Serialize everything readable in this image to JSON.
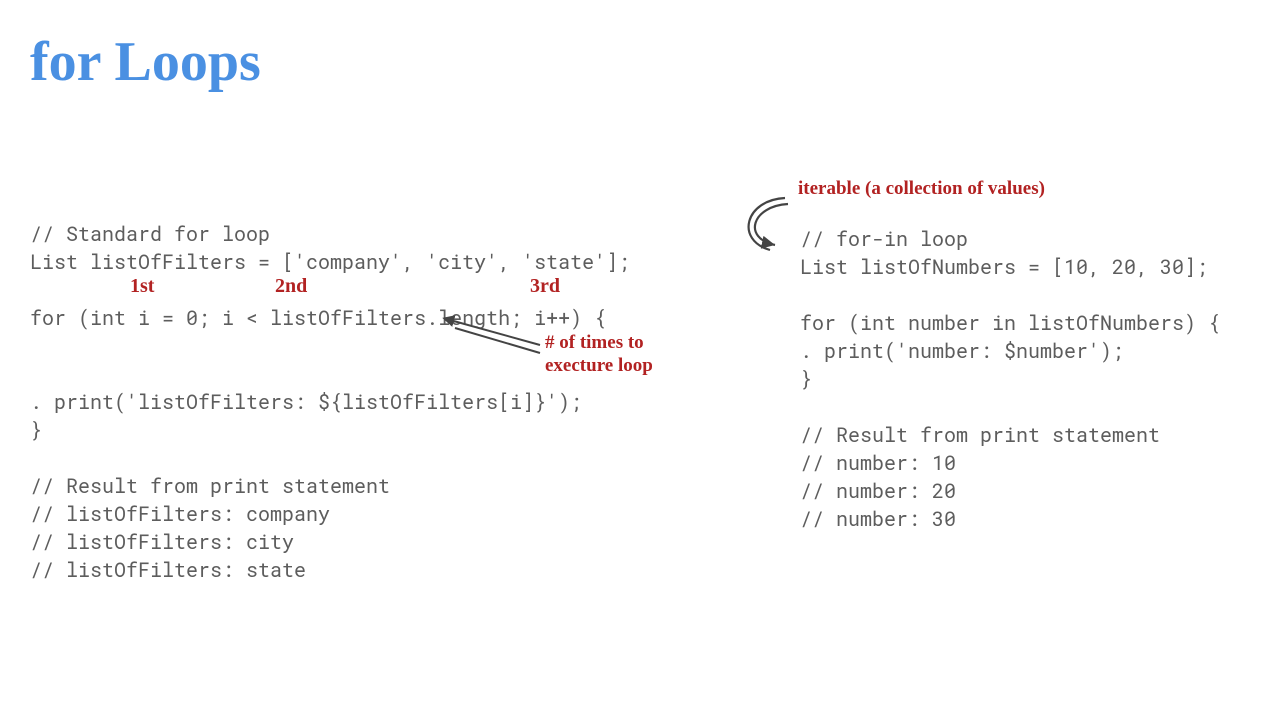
{
  "title": "for Loops",
  "left_code": "// Standard for loop\nList listOfFilters = ['company', 'city', 'state'];\n\nfor (int i = 0; i < listOfFilters.length; i++) {\n\n\n. print('listOfFilters: ${listOfFilters[i]}');\n}\n\n// Result from print statement\n// listOfFilters: company\n// listOfFilters: city\n// listOfFilters: state",
  "right_code": "// for-in loop\nList listOfNumbers = [10, 20, 30];\n\nfor (int number in listOfNumbers) {\n. print('number: $number');\n}\n\n// Result from print statement\n// number: 10\n// number: 20\n// number: 30",
  "annotations": {
    "first": "1st",
    "second": "2nd",
    "third": "3rd",
    "times_line1": "# of times to",
    "times_line2": "execture loop",
    "iterable": "iterable (a collection of values)"
  },
  "colors": {
    "title_blue": "#4A90E2",
    "code_gray": "#5d5d5d",
    "hand_red": "#B22222",
    "arrow_stroke": "#444444"
  }
}
